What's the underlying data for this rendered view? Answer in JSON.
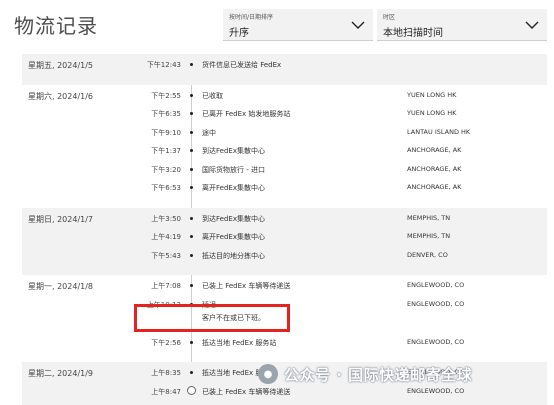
{
  "page": {
    "title": "物流记录"
  },
  "filters": {
    "sort": {
      "label": "按时间/日期排序",
      "value": "升序"
    },
    "time": {
      "label": "时区",
      "value": "本地扫描时间"
    }
  },
  "groups": [
    {
      "date": "星期五, 2024/1/5",
      "shaded": true,
      "events": [
        {
          "time": "下午12:43",
          "desc": "货件信息已发送给 FedEx",
          "loc": ""
        }
      ]
    },
    {
      "date": "星期六, 2024/1/6",
      "shaded": false,
      "events": [
        {
          "time": "下午2:55",
          "desc": "已收取",
          "loc": "YUEN LONG HK"
        },
        {
          "time": "下午6:35",
          "desc": "已离开 FedEx 始发地服务站",
          "loc": "YUEN LONG HK"
        },
        {
          "time": "下午9:10",
          "desc": "途中",
          "loc": "LANTAU ISLAND HK"
        },
        {
          "time": "下午1:37",
          "desc": "到达FedEx集散中心",
          "loc": "ANCHORAGE, AK"
        },
        {
          "time": "下午3:20",
          "desc": "国际货物放行 - 进口",
          "loc": "ANCHORAGE, AK"
        },
        {
          "time": "下午6:53",
          "desc": "离开FedEx集散中心",
          "loc": "ANCHORAGE, AK"
        }
      ]
    },
    {
      "date": "星期日, 2024/1/7",
      "shaded": true,
      "events": [
        {
          "time": "上午3:50",
          "desc": "到达FedEx集散中心",
          "loc": "MEMPHIS, TN"
        },
        {
          "time": "上午4:19",
          "desc": "离开FedEx集散中心",
          "loc": "MEMPHIS, TN"
        },
        {
          "time": "下午5:43",
          "desc": "抵达目的地分拣中心",
          "loc": "DENVER, CO"
        }
      ]
    },
    {
      "date": "星期一, 2024/1/8",
      "shaded": false,
      "events": [
        {
          "time": "上午7:08",
          "desc": "已装上 FedEx 车辆等待递送",
          "loc": "ENGLEWOOD, CO"
        },
        {
          "time": "上午10:12",
          "desc": "延迟",
          "desc2": "客户不在或已下班。",
          "loc": "ENGLEWOOD, CO"
        },
        {
          "time": "下午2:56",
          "desc": "抵达当地 FedEx 服务站",
          "loc": "ENGLEWOOD, CO"
        }
      ]
    },
    {
      "date": "星期二, 2024/1/9",
      "shaded": true,
      "events": [
        {
          "time": "上午8:35",
          "desc": "抵达当地 FedEx 服务站",
          "loc": "ENGLEWOOD, CO"
        },
        {
          "time": "上午8:47",
          "desc": "已装上 FedEx 车辆等待递送",
          "loc": "ENGLEWOOD, CO"
        }
      ]
    }
  ],
  "watermark": {
    "text": "公众号 · 国际快递邮寄全球"
  },
  "colors": {
    "highlight": "#e52421",
    "shaded_row": "#f2f2f2"
  }
}
